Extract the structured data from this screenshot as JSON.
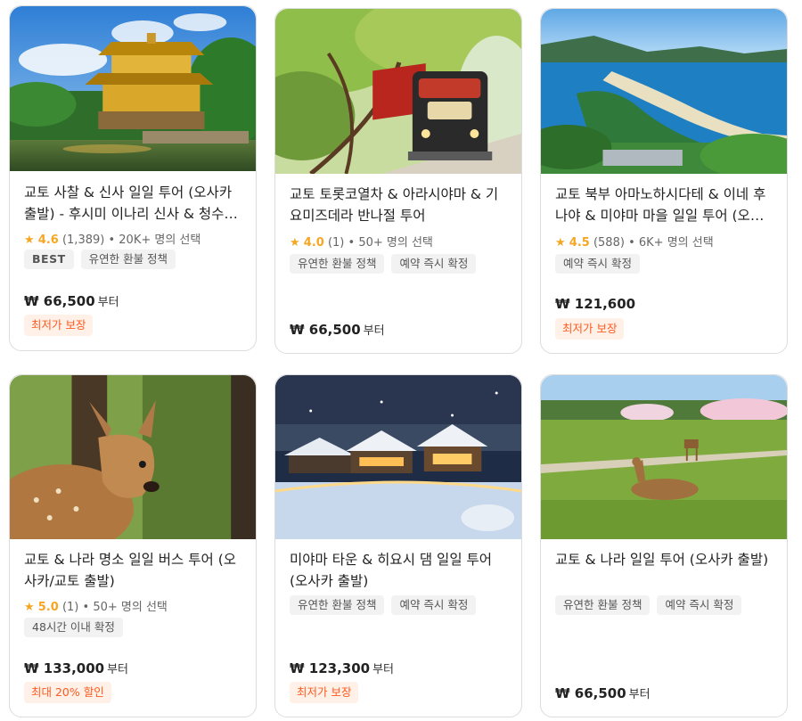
{
  "cards": [
    {
      "image": "kinkakuji-golden-pavilion",
      "title": "교토 사찰 & 신사 일일 투어 (오사카 출발) - 후시미 이나리 신사 & 청수사 & 금각사",
      "rating": {
        "score": "4.6",
        "reviews": "(1,389)",
        "chosen": "• 20K+ 명의 선택"
      },
      "tags": [
        "BEST",
        "유연한 환불 정책"
      ],
      "price": "₩ 66,500",
      "price_suffix": "부터",
      "badge": "최저가 보장"
    },
    {
      "image": "sagano-romantic-train",
      "title": "교토 토롯코열차 & 아라시야마 & 기요미즈데라 반나절 투어",
      "rating": {
        "score": "4.0",
        "reviews": "(1)",
        "chosen": "• 50+ 명의 선택"
      },
      "tags": [
        "유연한 환불 정책",
        "예약 즉시 확정"
      ],
      "price": "₩ 66,500",
      "price_suffix": "부터",
      "badge": ""
    },
    {
      "image": "amanohashidate-coast",
      "title": "교토 북부 아마노하시다테 & 이네 후나야 & 미야마 마을 일일 투어 (오사카/교토 출발)",
      "rating": {
        "score": "4.5",
        "reviews": "(588)",
        "chosen": "• 6K+ 명의 선택"
      },
      "tags": [
        "예약 즉시 확정"
      ],
      "price": "₩ 121,600",
      "price_suffix": "",
      "badge": "최저가 보장"
    },
    {
      "image": "nara-deer",
      "title": "교토 & 나라 명소 일일 버스 투어 (오사카/교토 출발)",
      "rating": {
        "score": "5.0",
        "reviews": "(1)",
        "chosen": "• 50+ 명의 선택"
      },
      "tags": [
        "48시간 이내 확정"
      ],
      "price": "₩ 133,000",
      "price_suffix": "부터",
      "badge": "최대 20% 할인"
    },
    {
      "image": "miyama-snow-village",
      "title": "미야마 타운 & 히요시 댐 일일 투어 (오사카 출발)",
      "rating": null,
      "tags": [
        "유연한 환불 정책",
        "예약 즉시 확정"
      ],
      "price": "₩ 123,300",
      "price_suffix": "부터",
      "badge": "최저가 보장"
    },
    {
      "image": "nara-park-deer",
      "title": "교토 & 나라 일일 투어 (오사카 출발)",
      "rating": null,
      "tags": [
        "유연한 환불 정책",
        "예약 즉시 확정"
      ],
      "price": "₩ 66,500",
      "price_suffix": "부터",
      "badge": ""
    }
  ],
  "colors": {
    "star": "#f5a623",
    "badge_text": "#ff5a1f",
    "badge_bg": "#fff1e8",
    "tag_bg": "#f2f2f2"
  }
}
